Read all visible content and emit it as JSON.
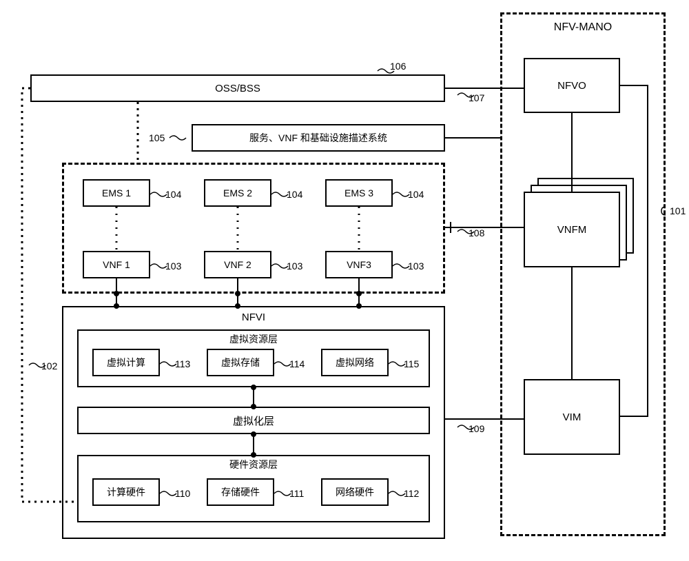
{
  "mano": {
    "title": "NFV-MANO",
    "nfvo": "NFVO",
    "vnfm": "VNFM",
    "vim": "VIM"
  },
  "oss": {
    "label": "OSS/BSS"
  },
  "desc": {
    "label": "服务、VNF 和基础设施描述系统"
  },
  "ems": {
    "e1": "EMS 1",
    "e2": "EMS 2",
    "e3": "EMS 3"
  },
  "vnf": {
    "v1": "VNF 1",
    "v2": "VNF 2",
    "v3": "VNF3"
  },
  "nfvi": {
    "title": "NFVI",
    "vrl_title": "虚拟资源层",
    "vcompute": "虚拟计算",
    "vstorage": "虚拟存储",
    "vnetwork": "虚拟网络",
    "vl_title": "虚拟化层",
    "hrl_title": "硬件资源层",
    "hcompute": "计算硬件",
    "hstorage": "存储硬件",
    "hnetwork": "网络硬件"
  },
  "nums": {
    "n101": "101",
    "n102": "102",
    "n103": "103",
    "n104": "104",
    "n105": "105",
    "n106": "106",
    "n107": "107",
    "n108": "108",
    "n109": "109",
    "n110": "110",
    "n111": "111",
    "n112": "112",
    "n113": "113",
    "n114": "114",
    "n115": "115"
  }
}
